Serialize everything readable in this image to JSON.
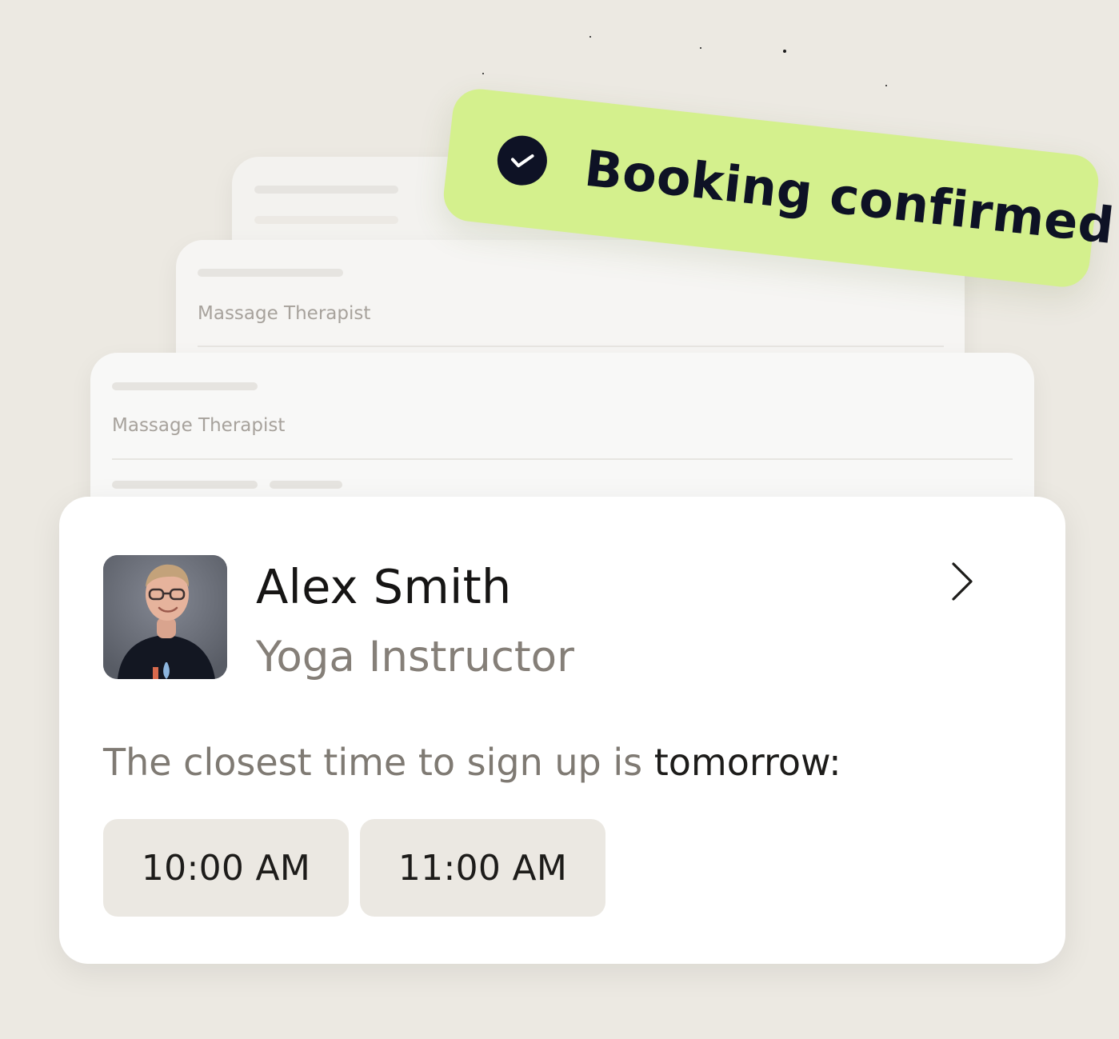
{
  "badge": {
    "text": "Booking confirmed",
    "color": "#d4f08d",
    "icon": "check-circle-icon"
  },
  "background_cards": [
    {
      "label": "Massage Therapist"
    },
    {
      "label": "Massage Therapist"
    }
  ],
  "profile": {
    "name": "Alex Smith",
    "role": "Yoga Instructor",
    "avatar_icon": "person-photo",
    "chevron_icon": "chevron-right-icon"
  },
  "availability": {
    "prefix": "The closest time to sign up is ",
    "day": "tomorrow",
    "suffix": ":",
    "slots": [
      "10:00 AM",
      "11:00 AM"
    ]
  },
  "colors": {
    "background": "#ece9e2",
    "card": "#ffffff",
    "slot_background": "#ebe8e2",
    "text_primary": "#161514",
    "text_secondary": "#857f78",
    "accent_green": "#d4f08d"
  }
}
